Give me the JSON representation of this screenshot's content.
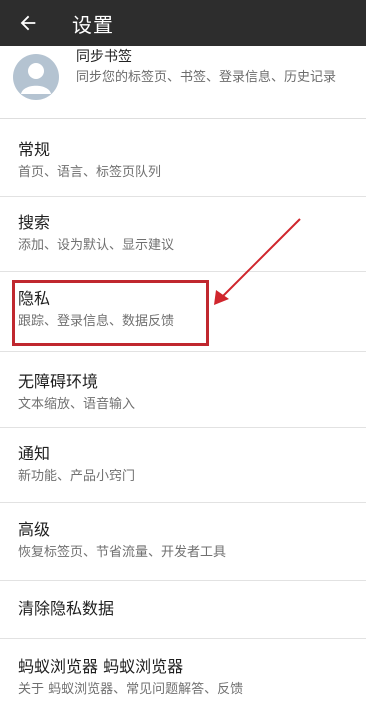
{
  "appbar": {
    "title": "设置",
    "back_icon": "arrow-left-icon"
  },
  "sync": {
    "title": "同步书签",
    "subtitle": "同步您的标签页、书签、登录信息、历史记录"
  },
  "items": [
    {
      "title": "常规",
      "subtitle": "首页、语言、标签页队列"
    },
    {
      "title": "搜索",
      "subtitle": "添加、设为默认、显示建议"
    },
    {
      "title": "隐私",
      "subtitle": "跟踪、登录信息、数据反馈"
    },
    {
      "title": "无障碍环境",
      "subtitle": "文本缩放、语音输入"
    },
    {
      "title": "通知",
      "subtitle": "新功能、产品小窍门"
    },
    {
      "title": "高级",
      "subtitle": "恢复标签页、节省流量、开发者工具"
    },
    {
      "title": "清除隐私数据",
      "subtitle": ""
    },
    {
      "title": "蚂蚁浏览器 蚂蚁浏览器",
      "subtitle": "关于 蚂蚁浏览器、常见问题解答、反馈"
    }
  ],
  "annotation": {
    "color": "#c0282f"
  }
}
